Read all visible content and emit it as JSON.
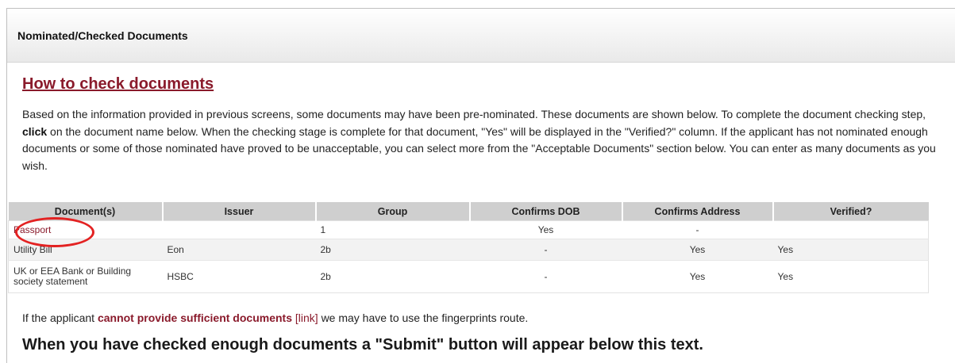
{
  "panel": {
    "title": "Nominated/Checked Documents"
  },
  "howto": {
    "heading": "How to check documents"
  },
  "intro": {
    "before_click": "Based on the information provided in previous screens, some documents may have been pre-nominated. These documents are shown below. To complete the document checking step,",
    "click_word": "click",
    "after_click": "on the document name below. When the checking stage is complete for that document, \"Yes\" will be displayed in the \"Verified?\" column. If the applicant has not nominated enough documents or some of those nominated have proved to be unacceptable, you can select more from the \"Acceptable Documents\" section below. You can enter as many documents as you wish."
  },
  "table": {
    "headers": [
      "Document(s)",
      "Issuer",
      "Group",
      "Confirms DOB",
      "Confirms Address",
      "Verified?"
    ],
    "rows": [
      {
        "document": "Passport",
        "issuer": "",
        "group": "1",
        "dob": "Yes",
        "address": "-",
        "verified": ""
      },
      {
        "document": "Utility Bill",
        "issuer": "Eon",
        "group": "2b",
        "dob": "-",
        "address": "Yes",
        "verified": "Yes"
      },
      {
        "document": "UK or EEA Bank or Building society statement",
        "issuer": "HSBC",
        "group": "2b",
        "dob": "-",
        "address": "Yes",
        "verified": "Yes"
      }
    ]
  },
  "note": {
    "before": "If the applicant",
    "bold": "cannot provide sufficient documents",
    "link": "[link]",
    "after": "we may have to use the fingerprints route."
  },
  "submit_note": "When you have checked enough documents a \"Submit\" button will appear below this text.",
  "colors": {
    "accent": "#8a1a2b",
    "highlight_circle": "#e32222",
    "header_bg": "#cfcfcf"
  }
}
